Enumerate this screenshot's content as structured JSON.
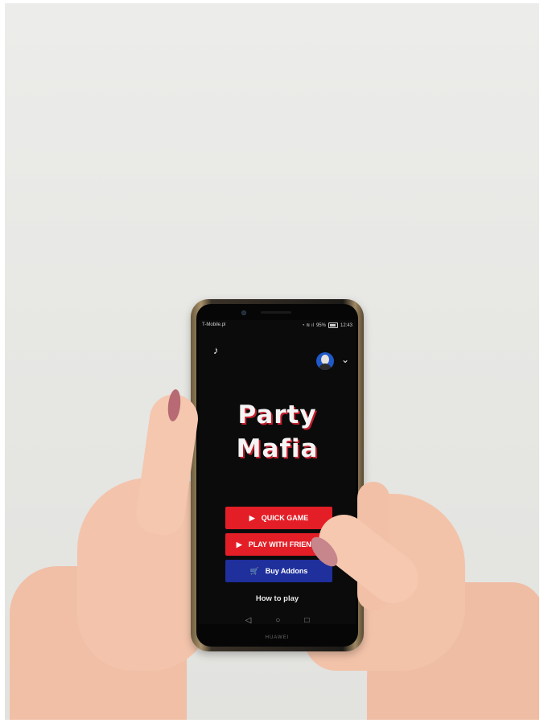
{
  "status_bar": {
    "carrier": "T-Mobile.pl",
    "battery": "95%",
    "time": "12:43"
  },
  "game": {
    "title_line1": "Party",
    "title_line2": "Mafia"
  },
  "menu": {
    "quick_game": "QUICK GAME",
    "play_with_friends": "PLAY WITH FRIENDS",
    "buy_addons": "Buy Addons",
    "how_to_play": "How to play"
  },
  "device": {
    "brand": "HUAWEI"
  },
  "icons": {
    "music": "music-note-icon",
    "avatar": "user-avatar",
    "dropdown": "chevron-down-icon",
    "play": "play-icon",
    "cart": "cart-icon",
    "back": "back-icon",
    "home": "home-icon",
    "recents": "recents-icon"
  },
  "colors": {
    "red_button": "#e31e26",
    "blue_button": "#1f2f9b",
    "title_shadow": "#c01e2c"
  }
}
